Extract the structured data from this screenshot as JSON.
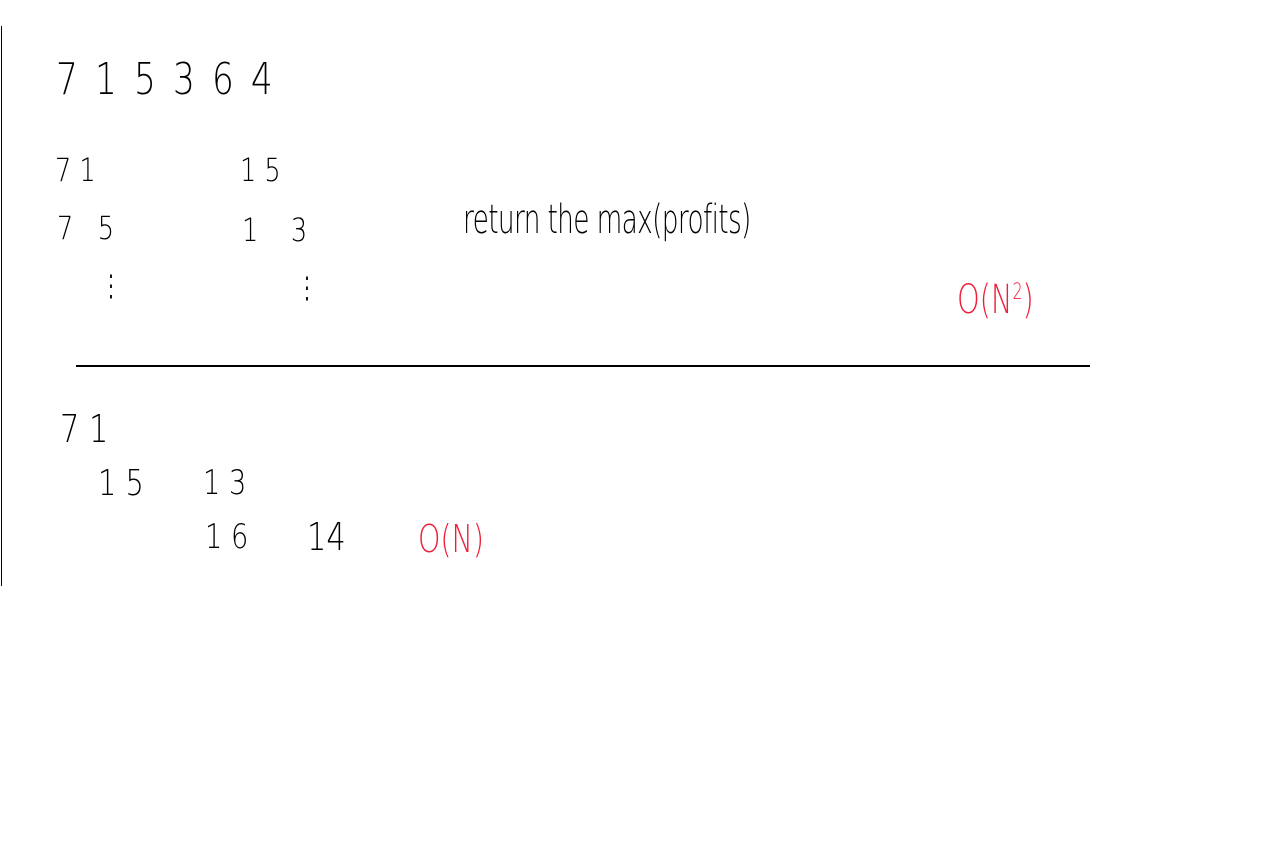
{
  "notes": {
    "sequence": "7 1 5 3 6 4",
    "pairs": {
      "row1_left": "7 1",
      "row1_right": "1 5",
      "row2_left": "7   5",
      "row2_right": "1    3",
      "dots": "⋮"
    },
    "annotation": "return the max(profits)",
    "complexity_quadratic_base": "O(N",
    "complexity_quadratic_exp": "2",
    "complexity_quadratic_close": ")",
    "bottom": {
      "line1": "7 1",
      "line2_a": "1 5",
      "line2_b": "1 3",
      "line3_a": "1 6",
      "line3_b": "14"
    },
    "complexity_linear": "O(N)"
  },
  "colors": {
    "ink": "#000000",
    "red_ink": "#ee1f3a",
    "background": "#ffffff"
  }
}
